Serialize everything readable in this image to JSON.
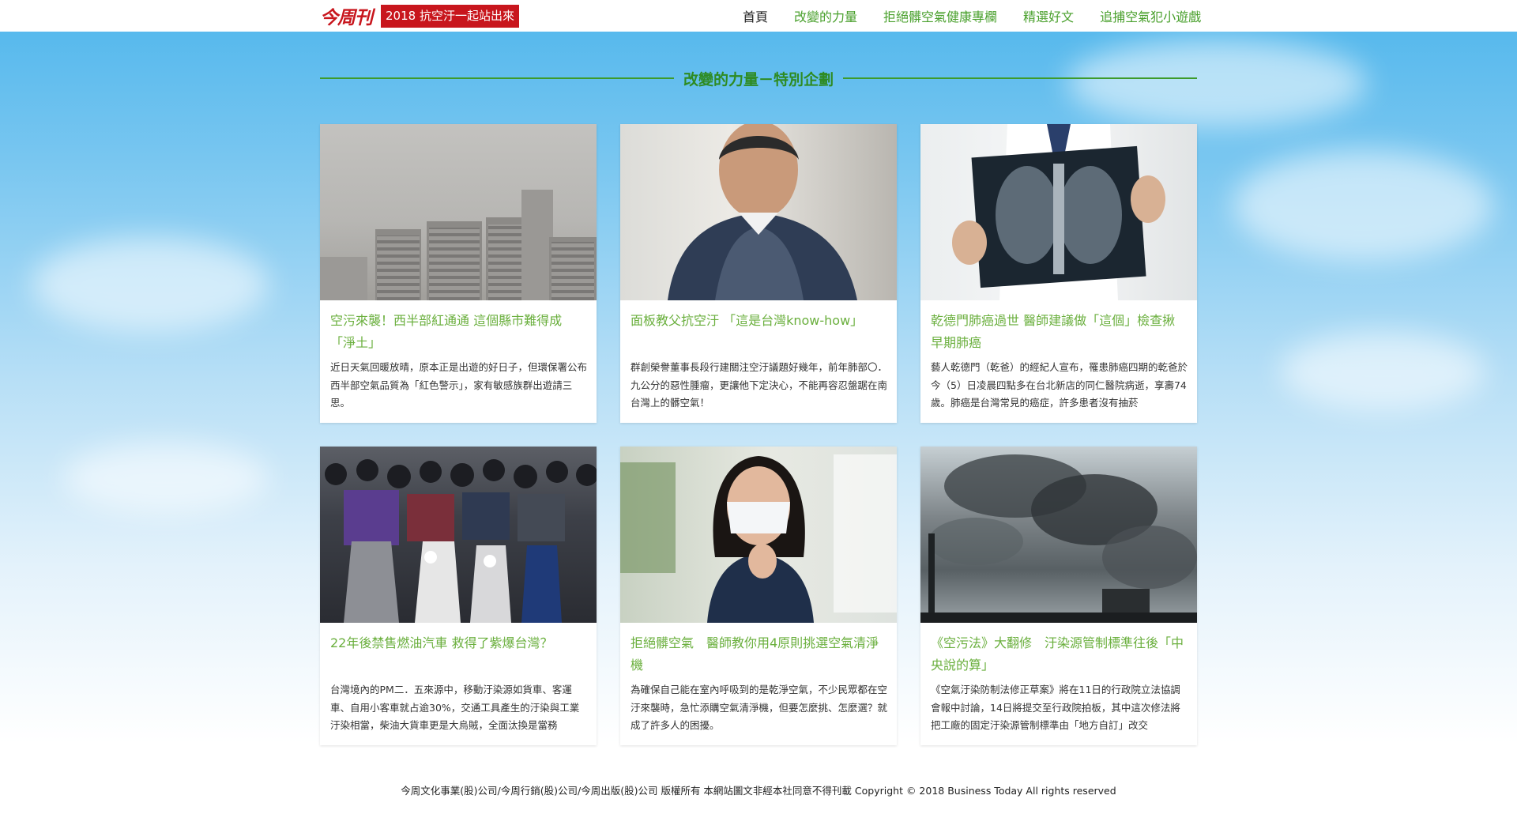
{
  "header": {
    "logo_text": "今周刊",
    "campaign_badge": "2018 抗空汙一起站出來",
    "nav": [
      "首頁",
      "改變的力量",
      "拒絕髒空氣健康專欄",
      "精選好文",
      "追捕空氣犯小遊戲"
    ]
  },
  "section_title": "改變的力量－特別企劃",
  "cards": [
    {
      "title": "空污來襲！西半部紅通通 這個縣市難得成「淨土」",
      "desc": "近日天氣回暖放晴，原本正是出遊的好日子，但環保署公布西半部空氣品質為「紅色警示」，家有敏感族群出遊請三思。"
    },
    {
      "title": "面板教父抗空汙 「這是台灣know-how」",
      "desc": "群創榮譽董事長段行建關注空汙議題好幾年，前年肺部〇．九公分的惡性腫瘤，更讓他下定決心，不能再容忍盤踞在南台灣上的髒空氣！"
    },
    {
      "title": "乾德門肺癌過世 醫師建議做「這個」檢查揪早期肺癌",
      "desc": "藝人乾德門（乾爸）的經紀人宣布，罹患肺癌四期的乾爸於今（5）日凌晨四點多在台北新店的同仁醫院病逝，享壽74歲。肺癌是台灣常見的癌症，許多患者沒有抽菸"
    },
    {
      "title": "22年後禁售燃油汽車 救得了紫爆台灣？",
      "desc": "台灣境內的PM二．五來源中，移動汙染源如貨車、客運車、自用小客車就占逾30%，交通工具產生的汙染與工業汙染相當，柴油大貨車更是大烏賊，全面汰換是當務"
    },
    {
      "title": "拒絕髒空氣　醫師教你用4原則挑選空氣清淨機",
      "desc": "為確保自己能在室內呼吸到的是乾淨空氣，不少民眾都在空汙來襲時，急忙添購空氣清淨機，但要怎麼挑、怎麼選？就成了許多人的困擾。"
    },
    {
      "title": "《空污法》大翻修　汙染源管制標準往後「中央說的算」",
      "desc": "《空氣汙染防制法修正草案》將在11日的行政院立法協調會報中討論，14日將提交至行政院拍板，其中這次修法將把工廠的固定汙染源管制標準由「地方自訂」改交"
    }
  ],
  "footer": "今周文化事業(股)公司/今周行銷(股)公司/今周出版(股)公司 版權所有 本網站圖文非經本社同意不得刊載 Copyright © 2018 Business Today All rights reserved",
  "colors": {
    "brand_red": "#c8161d",
    "accent_green": "#49a02c",
    "card_title_green": "#6aaf3d"
  }
}
